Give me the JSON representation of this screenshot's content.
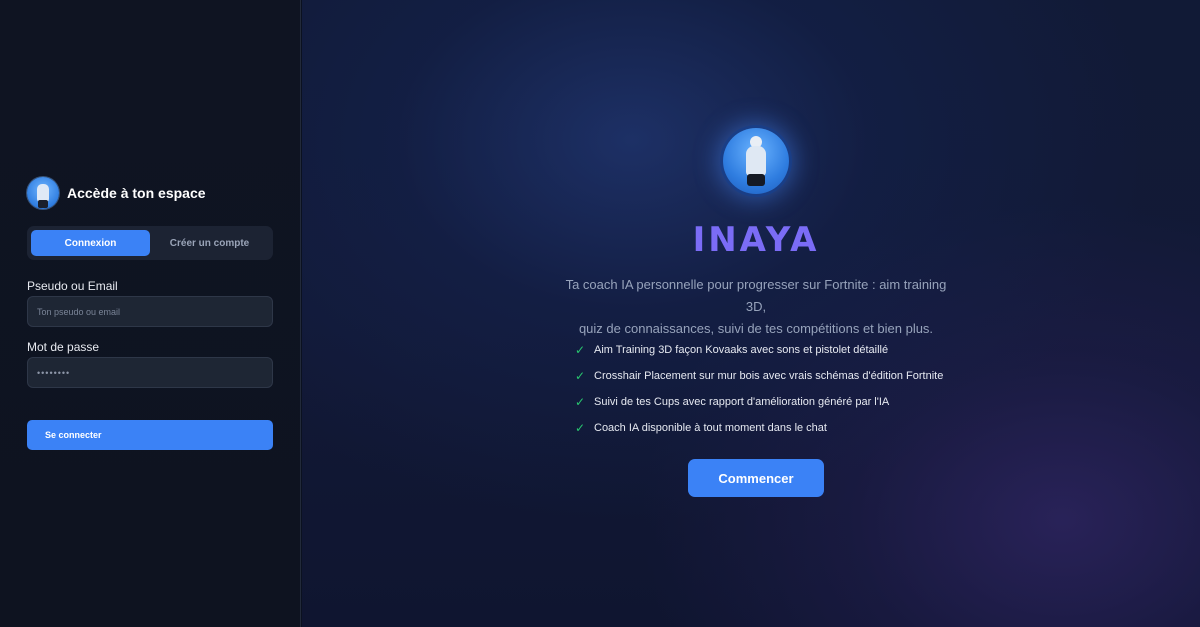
{
  "login": {
    "title": "Accède à ton espace",
    "tabs": [
      {
        "label": "Connexion",
        "active": true
      },
      {
        "label": "Créer un compte",
        "active": false
      }
    ],
    "fields": {
      "username": {
        "label": "Pseudo ou Email",
        "placeholder": "Ton pseudo ou email"
      },
      "password": {
        "label": "Mot de passe",
        "value": "••••••••"
      }
    },
    "submit_label": "Se connecter"
  },
  "hero": {
    "title": "INAYA",
    "subtitle_line1": "Ta coach IA personnelle pour progresser sur Fortnite : aim training 3D,",
    "subtitle_line2": "quiz de connaissances, suivi de tes compétitions et bien plus.",
    "features": [
      "Aim Training 3D façon Kovaaks avec sons et pistolet détaillé",
      "Crosshair Placement sur mur bois avec vrais schémas d'édition Fortnite",
      "Suivi de tes Cups avec rapport d'amélioration généré par l'IA",
      "Coach IA disponible à tout moment dans le chat"
    ],
    "check_icon": "✓",
    "cta_label": "Commencer"
  },
  "colors": {
    "accent": "#3b82f6",
    "title": "#7b6cf6",
    "check": "#28c76f"
  }
}
